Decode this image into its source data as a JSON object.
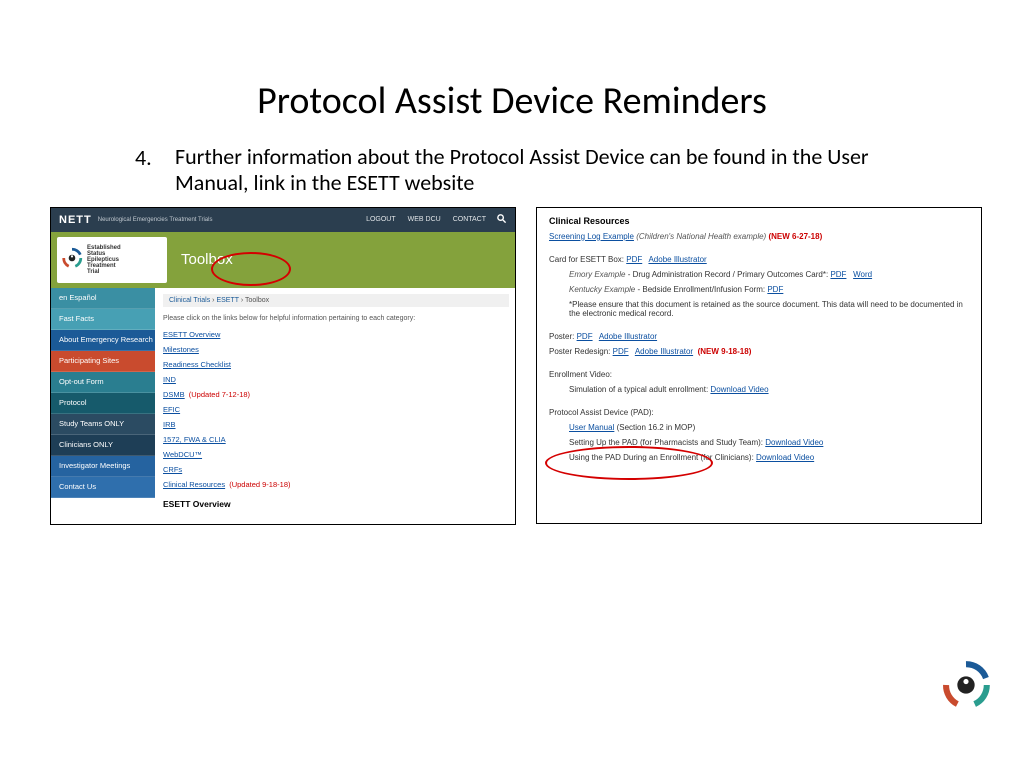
{
  "slide": {
    "title": "Protocol Assist Device Reminders",
    "bullet_number": "4.",
    "bullet_text": "Further information about the Protocol Assist Device can be found in the User Manual, link in the ESETT website"
  },
  "left": {
    "topbar": {
      "brand": "NETT",
      "tagline": "Neurological Emergencies Treatment Trials",
      "nav": [
        "LOGOUT",
        "WEB DCU",
        "CONTACT"
      ]
    },
    "logo_lines": "Established\nStatus\nEpilepticus\nTreatment\nTrial",
    "page_head": "Toolbox",
    "sidebar": [
      "en Español",
      "Fast Facts",
      "About Emergency Research",
      "Participating Sites",
      "Opt-out Form",
      "Protocol",
      "Study Teams ONLY",
      "Clinicians ONLY",
      "Investigator Meetings",
      "Contact Us"
    ],
    "breadcrumb": {
      "a": "Clinical Trials",
      "b": "ESETT",
      "c": "Toolbox"
    },
    "note": "Please click on the links below for helpful information pertaining to each category:",
    "links": {
      "overview": "ESETT Overview",
      "milestones": "Milestones",
      "readiness": "Readiness Checklist",
      "ind": "IND",
      "dsmb": "DSMB",
      "dsmb_tag": "(Updated 7-12-18)",
      "efic": "EFIC",
      "irb": "IRB",
      "fwa": "1572, FWA & CLIA",
      "webdcu": "WebDCU™",
      "crfs": "CRFs",
      "clinres": "Clinical Resources",
      "clinres_tag": "(Updated 9-18-18)"
    },
    "subhead": "ESETT Overview"
  },
  "right": {
    "head": "Clinical Resources",
    "screening": {
      "link": "Screening Log Example",
      "ital": "(Children's National Health example)",
      "tag": "(NEW 6-27-18)"
    },
    "card_line": {
      "label": "Card for ESETT Box:",
      "pdf": "PDF",
      "ai": "Adobe Illustrator"
    },
    "emory": {
      "pre": "Emory Example",
      "mid": " - Drug Administration Record / Primary Outcomes Card*:",
      "pdf": "PDF",
      "word": "Word"
    },
    "kentucky": {
      "pre": "Kentucky Example",
      "mid": " - Bedside Enrollment/Infusion Form:",
      "pdf": "PDF"
    },
    "disclaimer": "*Please ensure that this document is retained as the source document. This data will need to be documented in the electronic medical record.",
    "poster": {
      "label": "Poster:",
      "pdf": "PDF",
      "ai": "Adobe Illustrator"
    },
    "poster_redesign": {
      "label": "Poster Redesign:",
      "pdf": "PDF",
      "ai": "Adobe Illustrator",
      "tag": "(NEW 9-18-18)"
    },
    "enroll_video": {
      "label": "Enrollment Video:",
      "line": "Simulation of a typical adult enrollment:",
      "link": "Download Video"
    },
    "pad": {
      "head": "Protocol Assist Device (PAD):",
      "manual": "User Manual",
      "manual_tail": " (Section 16.2 in MOP)",
      "setup_pre": "Setting Up the PAD (for Pharmacists and Study Team):",
      "setup_link": "Download Video",
      "use_pre": "Using the PAD During an Enrollment (for Clinicians):",
      "use_link": "Download Video"
    }
  }
}
